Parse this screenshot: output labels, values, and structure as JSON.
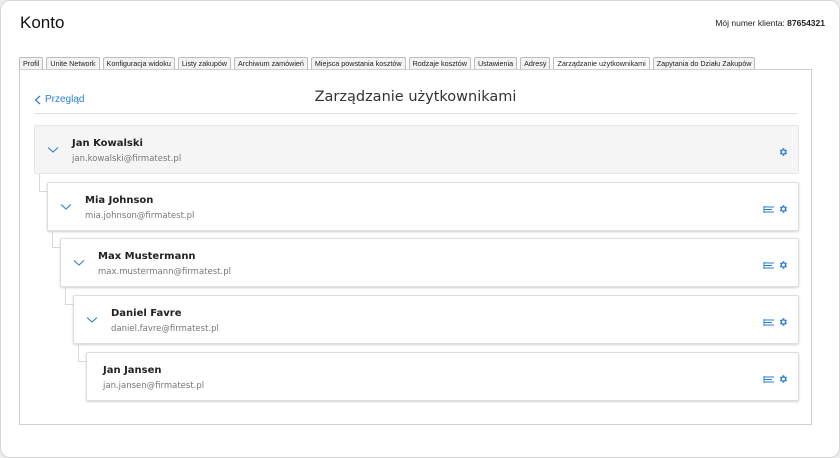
{
  "header": {
    "title": "Konto",
    "client_label": "Mój numer klienta:",
    "client_number": "87654321"
  },
  "tabs": [
    {
      "label": "Profil",
      "active": false
    },
    {
      "label": "Unite Network",
      "active": false
    },
    {
      "label": "Konfiguracja widoku",
      "active": false
    },
    {
      "label": "Listy zakupów",
      "active": false
    },
    {
      "label": "Archiwum zamówień",
      "active": false
    },
    {
      "label": "Miejsca powstania kosztów",
      "active": false
    },
    {
      "label": "Rodzaje kosztów",
      "active": false
    },
    {
      "label": "Ustawienia",
      "active": false
    },
    {
      "label": "Adresy",
      "active": false
    },
    {
      "label": "Zarządzanie użytkownikami",
      "active": true
    },
    {
      "label": "Zapytania do Działu Zakupów",
      "active": false
    }
  ],
  "panel": {
    "back_label": "Przegląd",
    "title": "Zarządzanie użytkownikami"
  },
  "users": [
    {
      "name": "Jan Kowalski",
      "email": "jan.kowalski@firmatest.pl",
      "expandable": true,
      "has_hierarchy_icon": false
    },
    {
      "name": "Mia Johnson",
      "email": "mia.johnson@firmatest.pl",
      "expandable": true,
      "has_hierarchy_icon": true
    },
    {
      "name": "Max Mustermann",
      "email": "max.mustermann@firmatest.pl",
      "expandable": true,
      "has_hierarchy_icon": true
    },
    {
      "name": "Daniel Favre",
      "email": "daniel.favre@firmatest.pl",
      "expandable": true,
      "has_hierarchy_icon": true
    },
    {
      "name": "Jan Jansen",
      "email": "jan.jansen@firmatest.pl",
      "expandable": false,
      "has_hierarchy_icon": true
    }
  ],
  "colors": {
    "accent": "#2a7fd4"
  },
  "icons": {
    "chevron": "chevron-down-icon",
    "settings": "gear-icon",
    "hierarchy": "hierarchy-icon",
    "back": "chevron-left-icon"
  }
}
